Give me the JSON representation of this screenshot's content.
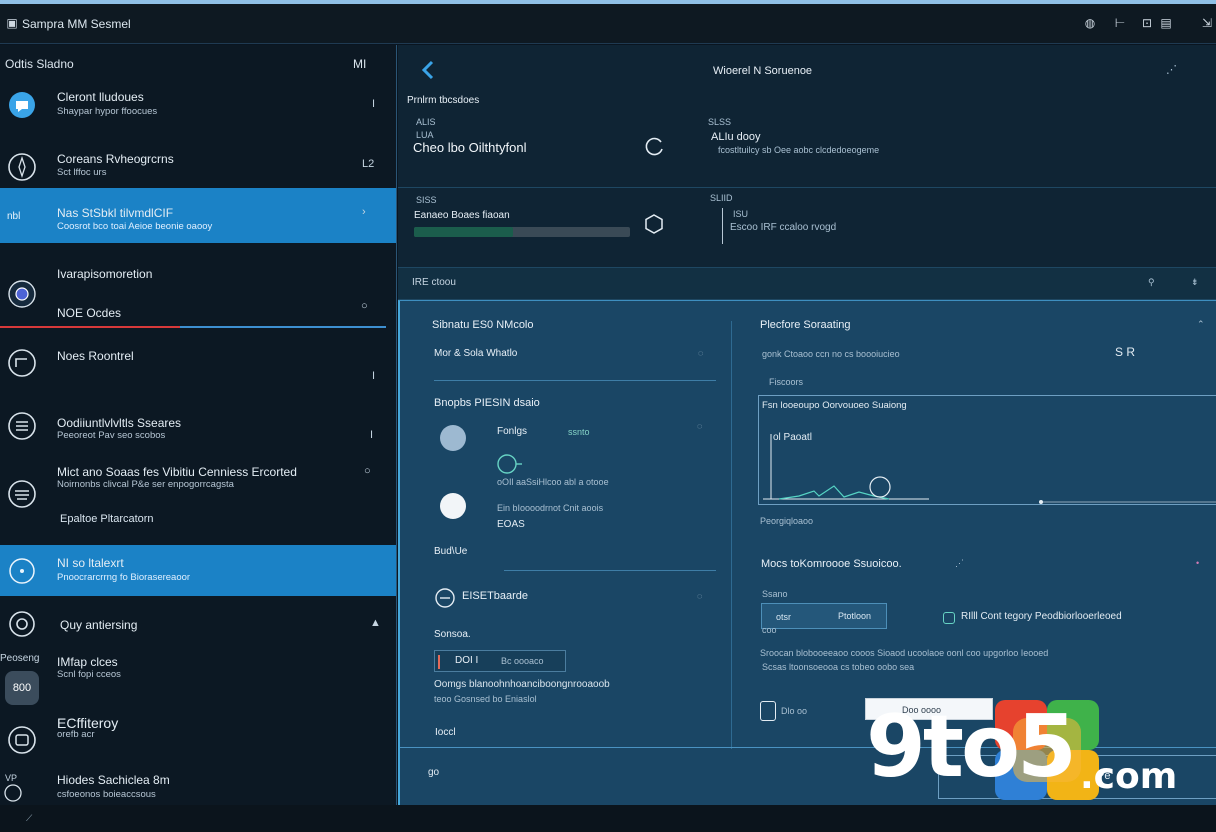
{
  "window": {
    "title": "Sampra MM Sesmel"
  },
  "sidebar": {
    "header_left": "Odtis  Sladno",
    "header_right": "MI",
    "items": [
      {
        "title": "Cleront lludoues",
        "subtitle": "Shaypar hypor ffoocues",
        "action": "I"
      },
      {
        "title": "Coreans Rvheogrcrns",
        "subtitle": "Sct lffoc urs",
        "action": "L2"
      },
      {
        "title": "Nas StSbkl tilvmdlCIF",
        "subtitle": "Coosrot bco toai Aeioe beonie oaooy",
        "action": "›",
        "badge": "nbl"
      },
      {
        "title": "Ivarapisomoretion",
        "subtitle": "NOE Ocdes",
        "action": "○"
      },
      {
        "title": "Noes Roontrel",
        "subtitle": "",
        "action": "I"
      },
      {
        "title": "Oodiiuntlvlvltls Sseares",
        "subtitle": "Peeoreot Pav seo scobos",
        "action": "I"
      },
      {
        "title": "Mict ano Soaas fes Vibitiu Cenniess Ercorted",
        "subtitle": "Noirnonbs clivcal P&e ser enpogorrcagsta",
        "extra": "Epaltoe Pltarcatorn",
        "action": "○"
      },
      {
        "title": "NI so ltalexrt",
        "subtitle": "Pnoocrarcrrng fo Biorasereaoor",
        "action": ""
      },
      {
        "title": "Quy antiersing",
        "subtitle": "",
        "action": "▲"
      },
      {
        "title": "IMfap clces",
        "subtitle": "Scnl fopi cceos",
        "side_label": "Peoseng",
        "badge": "800"
      },
      {
        "title": "ECffiteroy",
        "subtitle": "orefb acr",
        "action": ""
      },
      {
        "title": "Hiodes Sachiclea 8m",
        "subtitle": "csfoeonos boieaccsous",
        "badge": "VP"
      }
    ]
  },
  "detail": {
    "header_title": "Wioerel N Soruenoe",
    "section_label": "Prnlrm tbcsdoes",
    "card1": {
      "tag1": "ALIS",
      "tag2": "LUA",
      "title": "Cheo lbo Oilthtyfonl",
      "right_tag": "SLSS",
      "right_title": "ALIu dooy",
      "right_sub": "fcostltuilcy sb Oee aobc clcdedoeogeme"
    },
    "card2": {
      "tag1": "SISS",
      "title": "Eanaeo Boaes fiaoan",
      "right_tag": "SLIID",
      "right_label1": "ISU",
      "right_sub": "Escoo IRF ccaloo rvogd",
      "progress": 0.46
    },
    "mid_band_label": "IRE ctoou",
    "left_col": {
      "title": "Sibnatu ES0 NMcolo",
      "sub": "Mor & Sola Whatlo",
      "group_title": "Bnopbs PIESIN dsaio",
      "opt1_label": "Fonlgs",
      "opt1_tag": "ssnto",
      "opt2_line1": "oOIl aaSsiHlcoo abl a otooe",
      "opt3_line1": "Ein bIoooodrnot Cnit aoois",
      "opt3_line2": "EOAS",
      "section2": "Bud\\Ue",
      "row_title": "EISETbaarde",
      "label3": "Sonsoa.",
      "input_value": "DOI I",
      "input_suffix": "Bc oooaco",
      "note1": "Oomgs blanoohnhoanciboongnrooaoob",
      "note2": "teoo Gosnsed bo Eniaslol",
      "label4": "Ioccl"
    },
    "right_col": {
      "title": "Plecfore Soraating",
      "sub": "gonk Ctoaoo ccn no cs boooiucieo",
      "sub_right": "S   R",
      "chart_label": "Fiscoors",
      "chart_title": "Fsn looeoupo Oorvouoeo Suaiong",
      "chart_legend": "ol Paoatl",
      "chart_after": "Peorgiqloaoo",
      "section": "Mocs toKomroooe Ssuoicoo.",
      "field_label": "Ssano",
      "btn_text": "Ptotloon",
      "btn_prefix": "otsr",
      "field_sub": "coo",
      "check_label": "RIlll Cont tegory Peodbiorlooerleoed",
      "desc1": "Sroocan blobooeeaoo cooos Sioaod ucoolaoe oonl coo upgorloo Ieooed",
      "desc2": "Scsas ltoonsoeooa cs tobeo oobo sea",
      "small_label": "Dlo oo",
      "input_placeholder": "Doo oooo"
    },
    "bottom_left_icon": "go",
    "bottom_right_btn": "Pe"
  },
  "watermark": {
    "text": "9to5",
    "suffix": ".com"
  },
  "icons": [
    "app-icon",
    "clock-icon",
    "lock-icon",
    "menu-icon",
    "maximize-icon",
    "back-chevron-icon",
    "settings-icon",
    "refresh-icon",
    "chart-icon"
  ],
  "colors": {
    "accent": "#1b82c6",
    "panel": "#1a4665",
    "sidebar": "#0c1823",
    "title_bar": "#0e1922"
  }
}
